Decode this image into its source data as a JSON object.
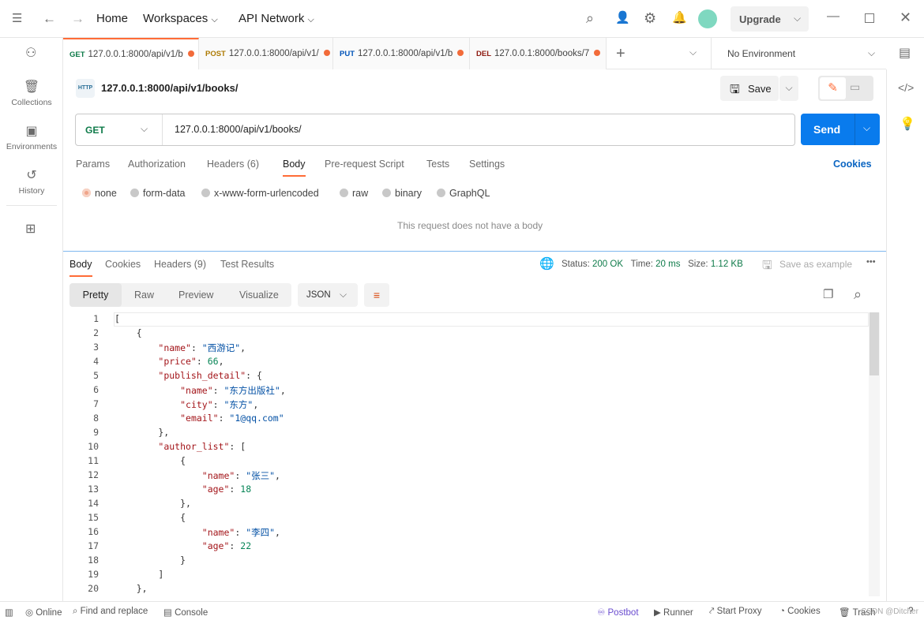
{
  "titlebar": {
    "home": "Home",
    "workspaces": "Workspaces",
    "api_network": "API Network",
    "upgrade": "Upgrade"
  },
  "sidebar": {
    "items": [
      {
        "label": "Collections",
        "icon": "trash-can-icon"
      },
      {
        "label": "Environments",
        "icon": "environment-icon"
      },
      {
        "label": "History",
        "icon": "history-icon"
      }
    ]
  },
  "tabs": [
    {
      "method": "GET",
      "url": "127.0.0.1:8000/api/v1/b",
      "color": "#0f7b4a"
    },
    {
      "method": "POST",
      "url": "127.0.0.1:8000/api/v1/",
      "color": "#ad7a03"
    },
    {
      "method": "PUT",
      "url": "127.0.0.1:8000/api/v1/b",
      "color": "#0053b8"
    },
    {
      "method": "DEL",
      "url": "127.0.0.1:8000/books/7",
      "color": "#8e1a10"
    }
  ],
  "environment": "No Environment",
  "request": {
    "name": "127.0.0.1:8000/api/v1/books/",
    "save": "Save",
    "method": "GET",
    "url": "127.0.0.1:8000/api/v1/books/",
    "send": "Send"
  },
  "request_tabs": [
    "Params",
    "Authorization",
    "Headers (6)",
    "Body",
    "Pre-request Script",
    "Tests",
    "Settings"
  ],
  "cookies": "Cookies",
  "body_types": [
    "none",
    "form-data",
    "x-www-form-urlencoded",
    "raw",
    "binary",
    "GraphQL"
  ],
  "no_body": "This request does not have a body",
  "response": {
    "tabs": [
      "Body",
      "Cookies",
      "Headers (9)",
      "Test Results"
    ],
    "status_label": "Status:",
    "status": "200 OK",
    "time_label": "Time:",
    "time": "20 ms",
    "size_label": "Size:",
    "size": "1.12 KB",
    "save_example": "Save as example",
    "views": [
      "Pretty",
      "Raw",
      "Preview",
      "Visualize"
    ],
    "format": "JSON"
  },
  "code": [
    [
      [
        "p",
        "["
      ]
    ],
    [
      [
        "p",
        "    {"
      ]
    ],
    [
      [
        "p",
        "        "
      ],
      [
        "k",
        "\"name\""
      ],
      [
        "p",
        ": "
      ],
      [
        "s",
        "\"西游记\""
      ],
      [
        "p",
        ","
      ]
    ],
    [
      [
        "p",
        "        "
      ],
      [
        "k",
        "\"price\""
      ],
      [
        "p",
        ": "
      ],
      [
        "n",
        "66"
      ],
      [
        "p",
        ","
      ]
    ],
    [
      [
        "p",
        "        "
      ],
      [
        "k",
        "\"publish_detail\""
      ],
      [
        "p",
        ": {"
      ]
    ],
    [
      [
        "p",
        "            "
      ],
      [
        "k",
        "\"name\""
      ],
      [
        "p",
        ": "
      ],
      [
        "s",
        "\"东方出版社\""
      ],
      [
        "p",
        ","
      ]
    ],
    [
      [
        "p",
        "            "
      ],
      [
        "k",
        "\"city\""
      ],
      [
        "p",
        ": "
      ],
      [
        "s",
        "\"东方\""
      ],
      [
        "p",
        ","
      ]
    ],
    [
      [
        "p",
        "            "
      ],
      [
        "k",
        "\"email\""
      ],
      [
        "p",
        ": "
      ],
      [
        "s",
        "\"1@qq.com\""
      ]
    ],
    [
      [
        "p",
        "        },"
      ]
    ],
    [
      [
        "p",
        "        "
      ],
      [
        "k",
        "\"author_list\""
      ],
      [
        "p",
        ": ["
      ]
    ],
    [
      [
        "p",
        "            {"
      ]
    ],
    [
      [
        "p",
        "                "
      ],
      [
        "k",
        "\"name\""
      ],
      [
        "p",
        ": "
      ],
      [
        "s",
        "\"张三\""
      ],
      [
        "p",
        ","
      ]
    ],
    [
      [
        "p",
        "                "
      ],
      [
        "k",
        "\"age\""
      ],
      [
        "p",
        ": "
      ],
      [
        "n",
        "18"
      ]
    ],
    [
      [
        "p",
        "            },"
      ]
    ],
    [
      [
        "p",
        "            {"
      ]
    ],
    [
      [
        "p",
        "                "
      ],
      [
        "k",
        "\"name\""
      ],
      [
        "p",
        ": "
      ],
      [
        "s",
        "\"李四\""
      ],
      [
        "p",
        ","
      ]
    ],
    [
      [
        "p",
        "                "
      ],
      [
        "k",
        "\"age\""
      ],
      [
        "p",
        ": "
      ],
      [
        "n",
        "22"
      ]
    ],
    [
      [
        "p",
        "            }"
      ]
    ],
    [
      [
        "p",
        "        ]"
      ]
    ],
    [
      [
        "p",
        "    },"
      ]
    ]
  ],
  "statusbar": {
    "online": "Online",
    "find": "Find and replace",
    "console": "Console",
    "postbot": "Postbot",
    "runner": "Runner",
    "proxy": "Start Proxy",
    "cookies": "Cookies",
    "trash": "Trash",
    "watermark": "CSDN @Ditcher"
  },
  "colors": {
    "accent": "#ff6c37",
    "send": "#097bed"
  }
}
